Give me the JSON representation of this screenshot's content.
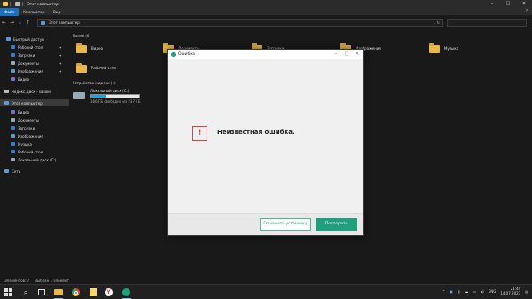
{
  "window": {
    "title": "Этот компьютер",
    "controls": [
      "–",
      "□",
      "✕"
    ]
  },
  "ribbon": {
    "tabs": [
      "Файл",
      "Компьютер",
      "Вид"
    ]
  },
  "address": {
    "path": "Этот компьютер",
    "search_placeholder": ""
  },
  "sidebar": {
    "items": [
      {
        "label": "Быстрый доступ",
        "icon": "star-icon",
        "color": "#5b9bd5"
      },
      {
        "label": "Рабочий стол",
        "icon": "desktop-icon",
        "color": "#2f7fd8"
      },
      {
        "label": "Загрузки",
        "icon": "download-icon",
        "color": "#2f7fd8"
      },
      {
        "label": "Документы",
        "icon": "document-icon",
        "color": "#9aa8b5"
      },
      {
        "label": "Изображения",
        "icon": "picture-icon",
        "color": "#5b9bd5"
      },
      {
        "label": "Видео",
        "icon": "video-icon",
        "color": "#7c6fd4"
      },
      {
        "label": "Яндекс.Диск - saiiaiie",
        "icon": "cloud-icon",
        "color": "#bbbbbb"
      },
      {
        "label": "Этот компьютер",
        "icon": "computer-icon",
        "color": "#5b9bd5"
      },
      {
        "label": "Видео",
        "icon": "video-icon",
        "color": "#7c6fd4"
      },
      {
        "label": "Документы",
        "icon": "document-icon",
        "color": "#9aa8b5"
      },
      {
        "label": "Загрузки",
        "icon": "download-icon",
        "color": "#2f7fd8"
      },
      {
        "label": "Изображения",
        "icon": "picture-icon",
        "color": "#5b9bd5"
      },
      {
        "label": "Музыка",
        "icon": "music-icon",
        "color": "#2f7fd8"
      },
      {
        "label": "Рабочий стол",
        "icon": "desktop-icon",
        "color": "#2f7fd8"
      },
      {
        "label": "Локальный диск (C:)",
        "icon": "drive-icon",
        "color": "#9aa8b5"
      },
      {
        "label": "Сеть",
        "icon": "network-icon",
        "color": "#5b9bd5"
      }
    ]
  },
  "main": {
    "folders_header": "Папки (6)",
    "folders": [
      "Видео",
      "Документы",
      "Загрузки",
      "Изображения",
      "Музыка",
      "Рабочий стол"
    ],
    "drives_header": "Устройства и диски (1)",
    "drive": {
      "name": "Локальный диск (C:)",
      "free_text": "166 ГБ свободно из 237 ГБ",
      "used_fraction": 0.3
    }
  },
  "dialog": {
    "title": "Ошибка",
    "error_icon": "!",
    "message": "Неизвестная ошибка.",
    "cancel_label": "Отменить установку",
    "retry_label": "Повторить",
    "accent": "#1f9f7c",
    "error_color": "#e0404a"
  },
  "status": {
    "items_count": "Элементов: 7",
    "selected": "Выбран 1 элемент"
  },
  "taskbar": {
    "lang": "ENG",
    "time": "21:44",
    "date": "14.07.2023"
  }
}
